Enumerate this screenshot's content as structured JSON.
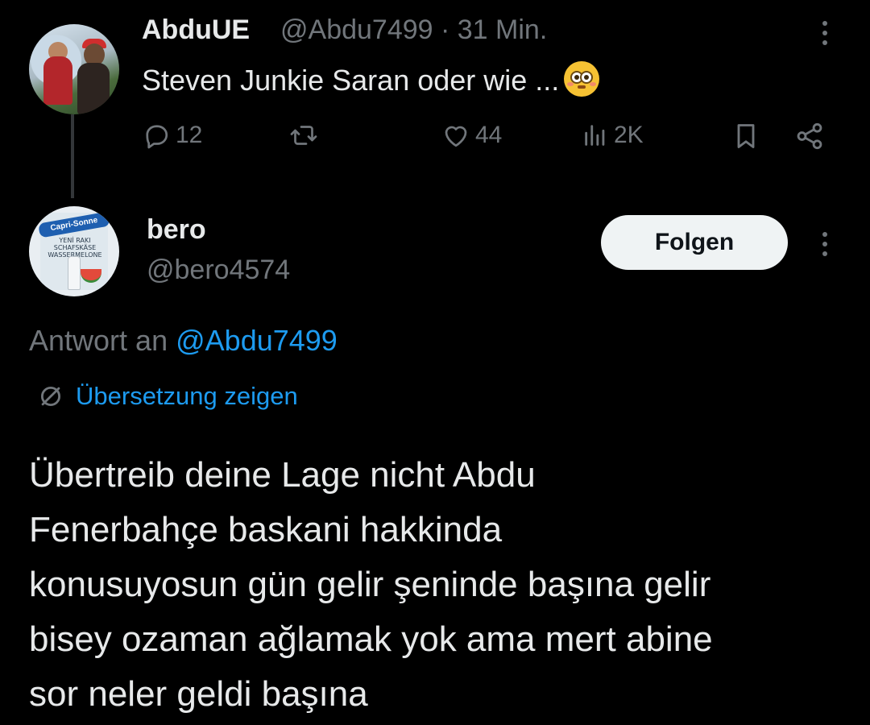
{
  "parent_tweet": {
    "display_name": "AbduUE",
    "meta": "@Abdu7499 · 31 Min.",
    "text": "Steven Junkie Saran oder wie ...",
    "emoji": "flushed-face",
    "actions": {
      "reply_count": "12",
      "retweet_count": "",
      "like_count": "44",
      "view_count": "2K"
    }
  },
  "reply_tweet": {
    "display_name": "bero",
    "handle": "@bero4574",
    "follow_label": "Folgen",
    "reply_to_prefix": "Antwort an",
    "reply_to_handle": "@Abdu7499",
    "translate_label": "Übersetzung zeigen",
    "avatar_brand": "Capri-Sonne",
    "avatar_label": "YENİ RAKI SCHAFSKÄSE WASSERMELONE",
    "body_lines": [
      "Übertreib deine Lage nicht Abdu",
      "Fenerbahçe baskani hakkinda",
      "konusuyosun gün gelir şeninde başına gelir",
      "bisey ozaman ağlamak yok ama mert abine",
      "sor neler geldi başına"
    ]
  },
  "colors": {
    "background": "#000000",
    "text": "#e7e9ea",
    "muted": "#71767b",
    "link": "#1d9bf0"
  }
}
